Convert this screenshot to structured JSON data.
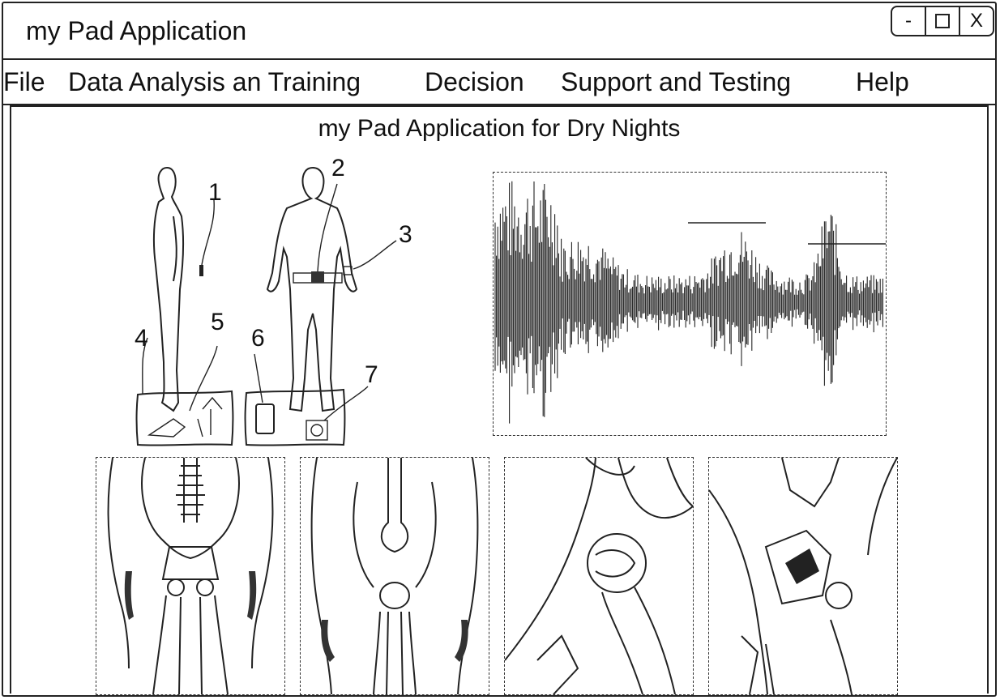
{
  "window": {
    "title": "my Pad Application",
    "controls": {
      "minimize": "-",
      "maximize": "□",
      "close": "X"
    }
  },
  "menu": {
    "items": [
      "File",
      "Data Analysis an Training",
      "Decision",
      "Support and Testing",
      "Help"
    ]
  },
  "main": {
    "heading": "my Pad Application for Dry Nights",
    "figure_callouts": [
      "1",
      "2",
      "3",
      "4",
      "5",
      "6",
      "7"
    ],
    "panels": [
      "figures-illustration",
      "waveform-signal",
      "pelvis-front-xray",
      "thigh-knee-xray",
      "hip-joint-xray",
      "hip-with-pad-xray"
    ]
  }
}
